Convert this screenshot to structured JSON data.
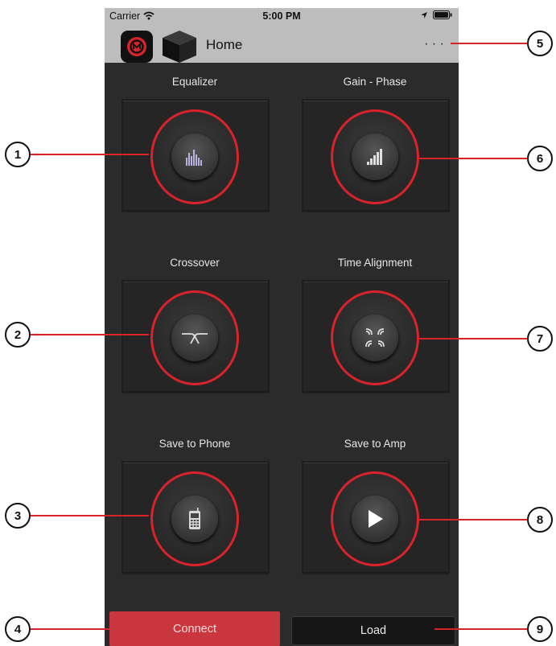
{
  "status": {
    "carrier": "Carrier",
    "time": "5:00 PM"
  },
  "nav": {
    "title": "Home",
    "more": "···"
  },
  "tiles": [
    {
      "label": "Equalizer",
      "icon": "equalizer-icon"
    },
    {
      "label": "Gain - Phase",
      "icon": "gain-phase-icon"
    },
    {
      "label": "Crossover",
      "icon": "crossover-icon"
    },
    {
      "label": "Time Alignment",
      "icon": "time-alignment-icon"
    },
    {
      "label": "Save to Phone",
      "icon": "phone-icon"
    },
    {
      "label": "Save to Amp",
      "icon": "play-icon"
    }
  ],
  "buttons": {
    "connect": "Connect",
    "load": "Load"
  },
  "callouts": [
    "1",
    "2",
    "3",
    "4",
    "5",
    "6",
    "7",
    "8",
    "9"
  ],
  "colors": {
    "accent": "#d9232b",
    "connect": "#c9363d",
    "background": "#2b2b2b",
    "navbar": "#bdbdbd"
  }
}
